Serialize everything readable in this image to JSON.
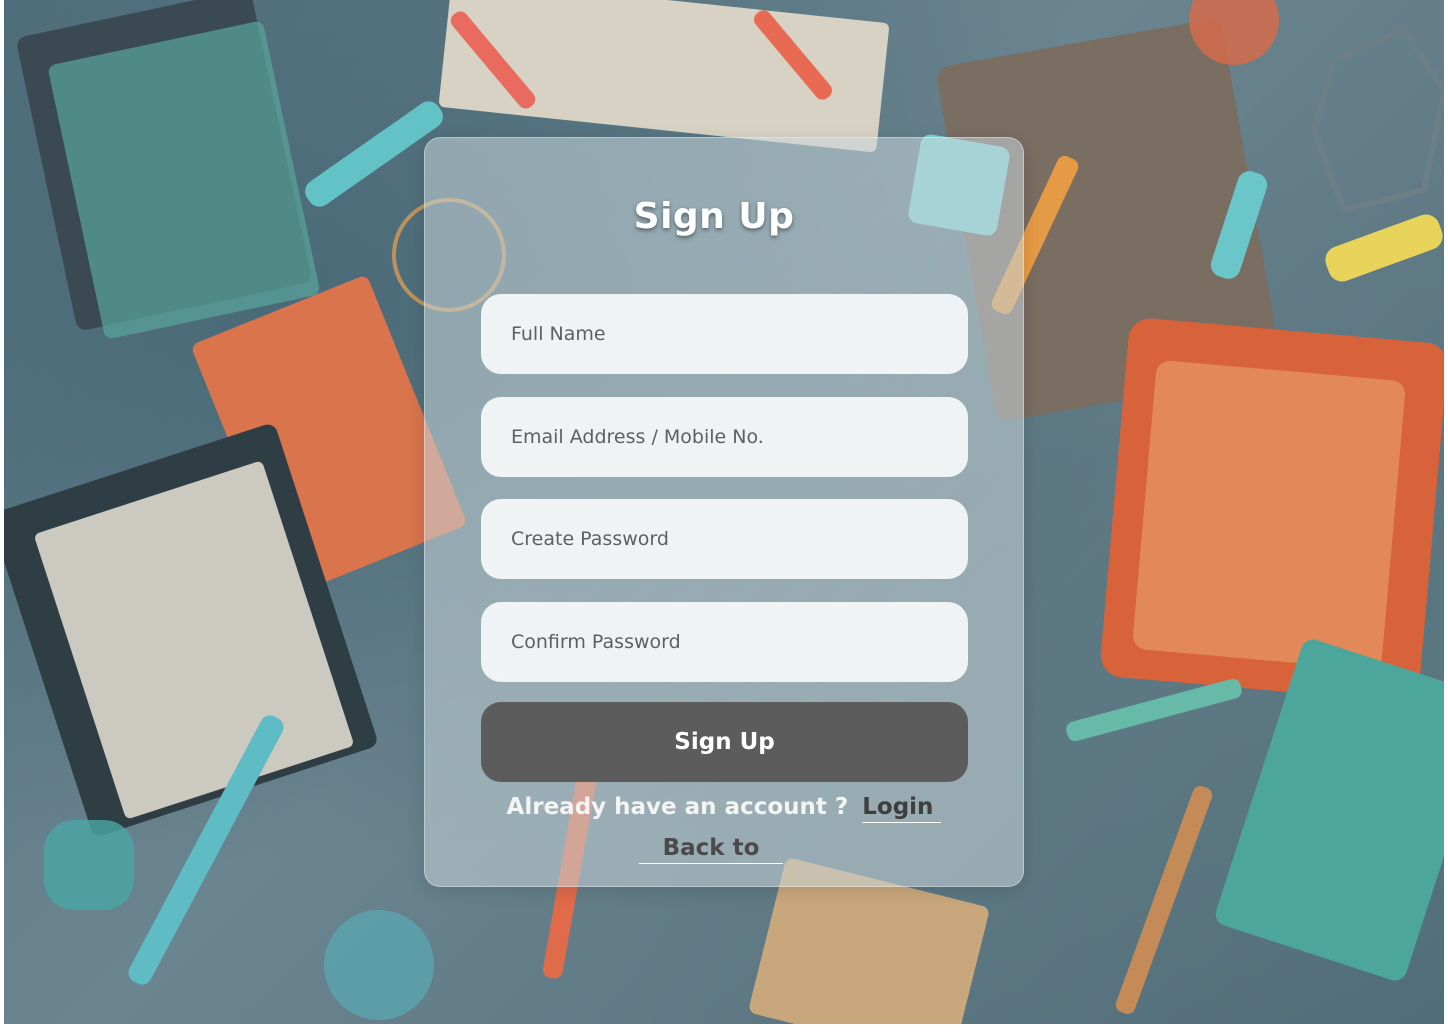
{
  "signup_card": {
    "title": "Sign Up",
    "fields": {
      "full_name": {
        "placeholder": "Full Name",
        "value": ""
      },
      "email": {
        "placeholder": "Email Address / Mobile No.",
        "value": ""
      },
      "create_password": {
        "placeholder": "Create Password",
        "value": ""
      },
      "confirm_password": {
        "placeholder": "Confirm Password",
        "value": ""
      }
    },
    "submit_label": "Sign Up",
    "login_prompt": "Already have an account ?",
    "login_link": "Login",
    "back_link": "Back to"
  },
  "colors": {
    "card_background": "#c8d6da",
    "button_background": "#5c5c5c",
    "title_text": "#ffffff"
  }
}
